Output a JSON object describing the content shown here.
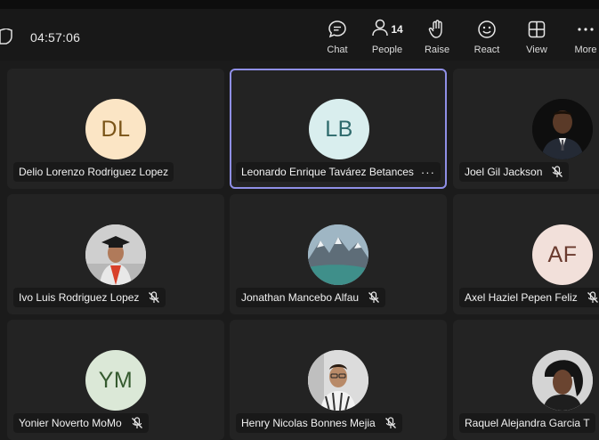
{
  "call": {
    "timer": "04:57:06"
  },
  "toolbar": {
    "chat_label": "Chat",
    "people_label": "People",
    "people_count": "14",
    "raise_label": "Raise",
    "react_label": "React",
    "view_label": "View",
    "more_label": "More"
  },
  "participants": [
    {
      "name": "Delio Lorenzo Rodriguez Lopez",
      "initials": "DL",
      "avatar_bg": "#fbe5c5",
      "initials_color": "#7a5418",
      "muted": false
    },
    {
      "name": "Leonardo Enrique Tavárez Betances",
      "initials": "LB",
      "avatar_bg": "#d9eeee",
      "initials_color": "#2e6a6c",
      "muted": false,
      "active_speaker": true
    },
    {
      "name": "Joel Gil Jackson",
      "initials": "",
      "avatar": "photo",
      "muted": true
    },
    {
      "name": "Ivo Luis Rodriguez Lopez",
      "initials": "",
      "avatar": "photo",
      "muted": true
    },
    {
      "name": "Jonathan Mancebo Alfau",
      "initials": "",
      "avatar": "photo",
      "muted": true
    },
    {
      "name": "Axel Haziel Pepen Feliz",
      "initials": "AF",
      "avatar_bg": "#f2e0da",
      "initials_color": "#6a3a2e",
      "muted": true
    },
    {
      "name": "Yonier Noverto MoMo",
      "initials": "YM",
      "avatar_bg": "#dbe8d7",
      "initials_color": "#355a2f",
      "muted": true
    },
    {
      "name": "Henry Nicolas Bonnes Mejia",
      "initials": "",
      "avatar": "photo",
      "muted": true
    },
    {
      "name": "Raquel Alejandra Garcia T",
      "initials": "",
      "avatar": "photo",
      "muted": false
    }
  ],
  "colors": {
    "active_border": "#8f8fe6",
    "tile_bg": "#232323",
    "app_bg": "#1b1b1b"
  }
}
